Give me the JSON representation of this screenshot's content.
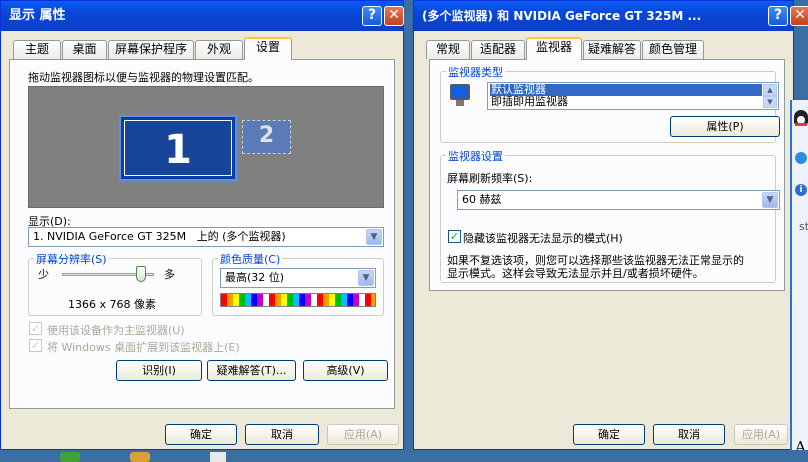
{
  "left_window": {
    "title": "显示 属性",
    "tabs": [
      "主题",
      "桌面",
      "屏幕保护程序",
      "外观",
      "设置"
    ],
    "instruction": "拖动监视器图标以便与监视器的物理设置匹配。",
    "monitor_primary": "1",
    "monitor_secondary": "2",
    "display_label": "显示(D):",
    "display_value": "1. NVIDIA GeForce GT 325M   上的 (多个监视器)",
    "resolution_group": "屏幕分辨率(S)",
    "less_label": "少",
    "more_label": "多",
    "resolution_value": "1366 x 768 像素",
    "color_group": "颜色质量(C)",
    "color_value": "最高(32 位)",
    "primary_checkbox": "使用该设备作为主监视器(U)",
    "extend_checkbox": "将 Windows 桌面扩展到该监视器上(E)",
    "identify_button": "识别(I)",
    "troubleshoot_button": "疑难解答(T)...",
    "advanced_button": "高级(V)",
    "ok_button": "确定",
    "cancel_button": "取消",
    "apply_button": "应用(A)"
  },
  "right_window": {
    "title": "(多个监视器) 和 NVIDIA GeForce GT 325M   ...",
    "tabs": [
      "常规",
      "适配器",
      "监视器",
      "疑难解答",
      "颜色管理"
    ],
    "monitor_type_group": "监视器类型",
    "monitor_list": [
      "默认监视器",
      "即插即用监视器"
    ],
    "properties_button": "属性(P)",
    "monitor_settings_group": "监视器设置",
    "refresh_label": "屏幕刷新频率(S):",
    "refresh_value": "60 赫兹",
    "hide_modes_checkbox": "隐藏该监视器无法显示的模式(H)",
    "hide_modes_desc_1": "如果不复选该项，则您可以选择那些该监视器无法正常显示的",
    "hide_modes_desc_2": "显示模式。这样会导致无法显示并且/或者损坏硬件。",
    "ok_button": "确定",
    "cancel_button": "取消",
    "apply_button": "应用(A)"
  },
  "side_panel": {
    "text_st": "st",
    "text_a": "A"
  }
}
